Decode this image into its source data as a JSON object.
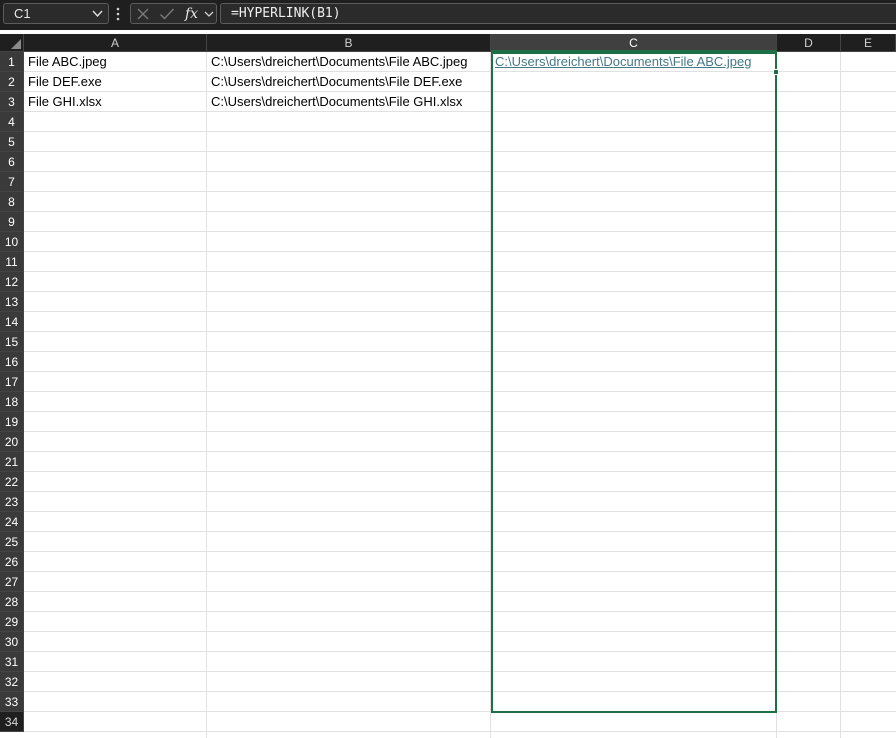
{
  "formula_bar": {
    "name_box": "C1",
    "formula": "=HYPERLINK(B1)"
  },
  "columns": [
    "A",
    "B",
    "C",
    "D",
    "E"
  ],
  "selected_column": "C",
  "rows": [
    "1",
    "2",
    "3",
    "4",
    "5",
    "6",
    "7",
    "8",
    "9",
    "10",
    "11",
    "12",
    "13",
    "14",
    "15",
    "16",
    "17",
    "18",
    "19",
    "20",
    "21",
    "22",
    "23",
    "24",
    "25",
    "26",
    "27",
    "28",
    "29",
    "30",
    "31",
    "32",
    "33",
    "34"
  ],
  "selected_rows": [
    "1",
    "2",
    "3",
    "4",
    "5",
    "6",
    "7",
    "8",
    "9",
    "10",
    "11",
    "12",
    "13",
    "14",
    "15",
    "16",
    "17",
    "18",
    "19",
    "20",
    "21",
    "22",
    "23",
    "24",
    "25",
    "26",
    "27",
    "28",
    "29",
    "30",
    "31",
    "32",
    "33"
  ],
  "cells": {
    "A1": "File ABC.jpeg",
    "A2": "File DEF.exe",
    "A3": "File GHI.xlsx",
    "B1": "C:\\Users\\dreichert\\Documents\\File ABC.jpeg",
    "B2": "C:\\Users\\dreichert\\Documents\\File DEF.exe",
    "B3": "C:\\Users\\dreichert\\Documents\\File GHI.xlsx",
    "C1": "C:\\Users\\dreichert\\Documents\\File ABC.jpeg"
  },
  "icons": {
    "name_box_dropdown": "chevron-down-icon",
    "more_options": "vertical-ellipsis-icon",
    "cancel": "x-icon",
    "enter": "check-icon",
    "insert_function": "fx-icon",
    "fx_dropdown": "chevron-down-icon"
  },
  "colors": {
    "selection": "#1e6f45",
    "hyperlink": "#467886",
    "chrome": "#1f1f1f"
  }
}
